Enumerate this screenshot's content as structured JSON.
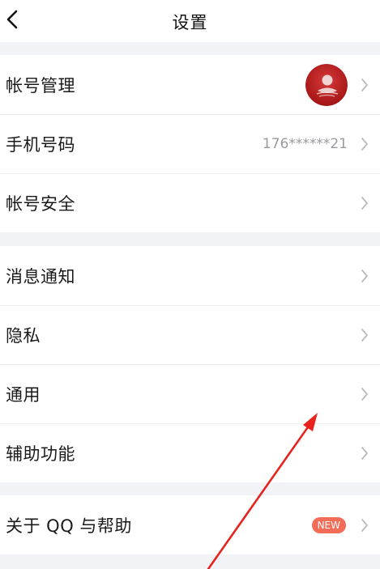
{
  "header": {
    "title": "设置",
    "back_icon": "chevron-left-icon"
  },
  "group1": {
    "items": [
      {
        "label": "帐号管理",
        "trailing": "avatar"
      },
      {
        "label": "手机号码",
        "value": "176******21"
      },
      {
        "label": "帐号安全"
      }
    ]
  },
  "group2": {
    "items": [
      {
        "label": "消息通知"
      },
      {
        "label": "隐私"
      },
      {
        "label": "通用"
      },
      {
        "label": "辅助功能"
      }
    ]
  },
  "group3": {
    "items": [
      {
        "label": "关于 QQ 与帮助",
        "badge": "NEW"
      }
    ]
  },
  "colors": {
    "background": "#f2f3f7",
    "badge": "#f36c58",
    "annotation_arrow": "#e8231d",
    "avatar": "#c41d1d"
  }
}
